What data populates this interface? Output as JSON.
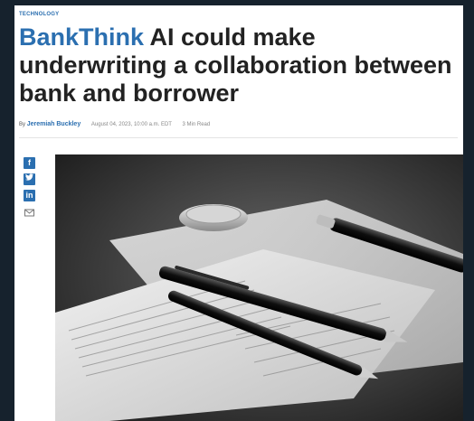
{
  "article": {
    "section": "TECHNOLOGY",
    "brand": "BankThink",
    "headline": "AI could make underwriting a collaboration between bank and borrower",
    "by_label": "By",
    "author": "Jeremiah Buckley",
    "date": "August 04, 2023, 10:00 a.m. EDT",
    "read_time": "3 Min Read"
  },
  "share": {
    "facebook": "f",
    "linkedin": "in",
    "icons": [
      "facebook-icon",
      "twitter-icon",
      "linkedin-icon",
      "mail-icon"
    ]
  },
  "colors": {
    "accent": "#2b6fb0",
    "page_bg": "#16222d"
  }
}
